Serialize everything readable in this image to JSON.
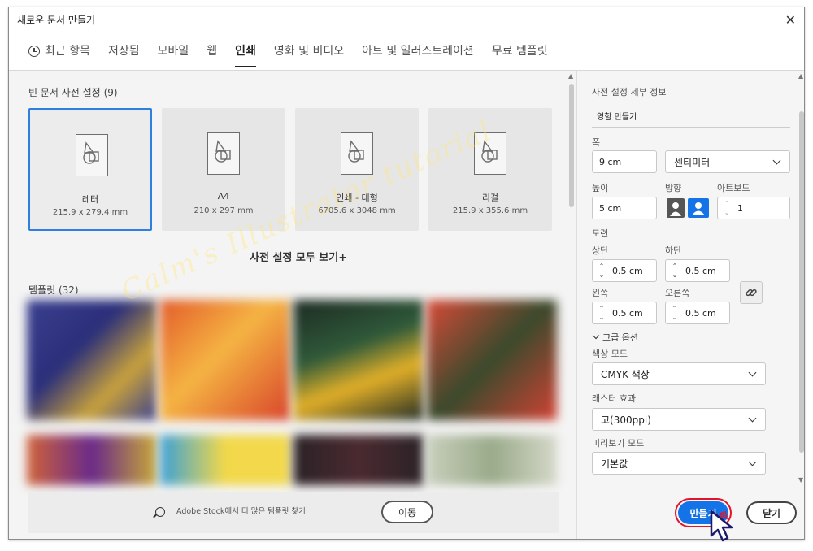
{
  "window": {
    "title": "새로운 문서 만들기"
  },
  "tabs": [
    {
      "label": "최근 항목"
    },
    {
      "label": "저장됨"
    },
    {
      "label": "모바일"
    },
    {
      "label": "웹"
    },
    {
      "label": "인쇄"
    },
    {
      "label": "영화 및 비디오"
    },
    {
      "label": "아트 및 일러스트레이션"
    },
    {
      "label": "무료 템플릿"
    }
  ],
  "blank_presets": {
    "title": "빈 문서 사전 설정",
    "count": "(9)",
    "items": [
      {
        "name": "레터",
        "size": "215.9 x 279.4 mm"
      },
      {
        "name": "A4",
        "size": "210 x 297 mm"
      },
      {
        "name": "인쇄 - 대형",
        "size": "6705.6 x 3048 mm"
      },
      {
        "name": "리걸",
        "size": "215.9 x 355.6 mm"
      }
    ],
    "see_all": "사전 설정 모두 보기+"
  },
  "templates": {
    "title": "템플릿",
    "count": "(32)"
  },
  "stock_search": {
    "placeholder": "Adobe Stock에서 더 많은 템플릿 찾기",
    "go": "이동"
  },
  "details": {
    "header": "사전 설정 세부 정보",
    "doc_name": "영함 만들기",
    "width_label": "폭",
    "width_value": "9 cm",
    "unit": "센티미터",
    "height_label": "높이",
    "height_value": "5 cm",
    "orientation_label": "방향",
    "artboard_label": "아트보드",
    "artboard_value": "1",
    "bleed_label": "도련",
    "top_label": "상단",
    "top_value": "0.5 cm",
    "bottom_label": "하단",
    "bottom_value": "0.5 cm",
    "left_label": "왼쪽",
    "left_value": "0.5 cm",
    "right_label": "오른쪽",
    "right_value": "0.5 cm",
    "advanced_label": "고급 옵션",
    "color_mode_label": "색상 모드",
    "color_mode_value": "CMYK 색상",
    "raster_label": "래스터 효과",
    "raster_value": "고(300ppi)",
    "preview_label": "미리보기 모드",
    "preview_value": "기본값"
  },
  "actions": {
    "create": "만들기",
    "close": "닫기"
  },
  "annotation": {
    "click": "클릭"
  },
  "watermark": "Calm's Illustrator tutorial",
  "colors": {
    "accent": "#1473e6",
    "highlight": "#e3142a",
    "selected_border": "#2d7fe0"
  }
}
